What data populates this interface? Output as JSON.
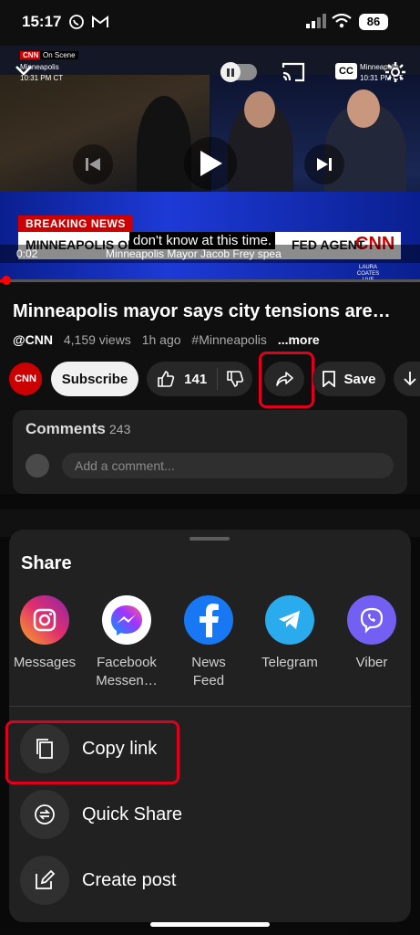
{
  "status_bar": {
    "time": "15:17",
    "battery": "86"
  },
  "video": {
    "on_scene_tag": "On Scene",
    "location_left": "Minneapolis",
    "time_left": "10:31 PM CT",
    "location_right": "Minneapolis",
    "time_right": "10:31 PM CT",
    "breaking_label": "BREAKING NEWS",
    "ticker_headline": "MINNEAPOLIS OFFICIALS",
    "ticker_right": "FED AGENT",
    "caption": "don't know at this time.",
    "timecode": "0:02",
    "subtitle_line": "Minneapolis Mayor Jacob Frey spea",
    "anchor_tag": "LAURA COATES LIVE",
    "brand": "CNN",
    "cc_label": "CC",
    "progress": 0.01
  },
  "metadata": {
    "title": "Minneapolis mayor says city tensions are…",
    "channel": "@CNN",
    "views": "4,159 views",
    "age": "1h ago",
    "hashtag": "#Minneapolis",
    "more": "...more"
  },
  "actions": {
    "channel_logo": "CNN",
    "subscribe_label": "Subscribe",
    "like_count": "141",
    "save_label": "Save"
  },
  "comments": {
    "title": "Comments",
    "count": "243",
    "placeholder": "Add a comment..."
  },
  "share_sheet": {
    "title": "Share",
    "apps": [
      {
        "label": "Messages",
        "color": "#e1306c",
        "icon": "instagram-icon"
      },
      {
        "label": "Facebook Messen…",
        "color": "#ffffff",
        "icon": "messenger-icon"
      },
      {
        "label": "News Feed",
        "color": "#1877f2",
        "icon": "facebook-icon"
      },
      {
        "label": "Telegram",
        "color": "#2aabee",
        "icon": "telegram-icon"
      },
      {
        "label": "Viber",
        "color": "#7360f2",
        "icon": "viber-icon"
      }
    ],
    "rows": [
      {
        "label": "Copy link",
        "icon": "copy-icon"
      },
      {
        "label": "Quick Share",
        "icon": "quick-share-icon"
      },
      {
        "label": "Create post",
        "icon": "edit-icon"
      }
    ]
  },
  "colors": {
    "highlight": "#e0001b",
    "progress": "#ff0000",
    "sheet_bg": "#212121"
  }
}
